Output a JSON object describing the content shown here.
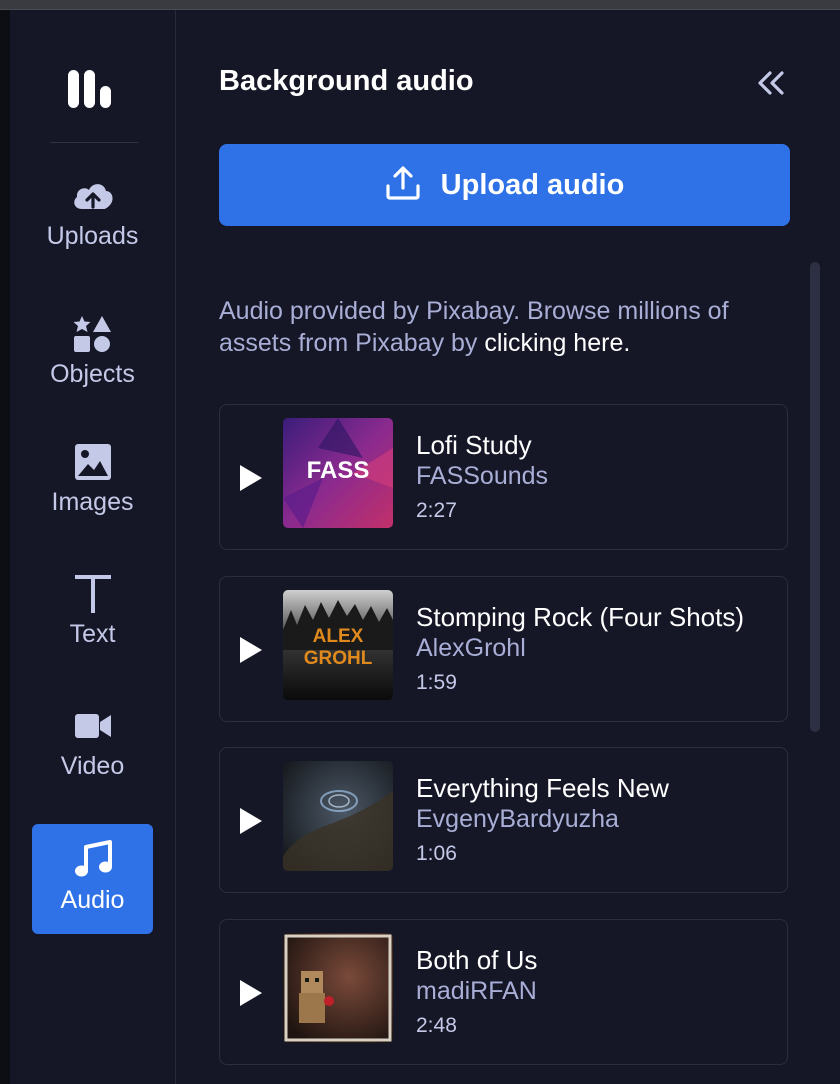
{
  "sidebar": {
    "items": [
      {
        "label": "Uploads",
        "icon": "cloud-upload-icon"
      },
      {
        "label": "Objects",
        "icon": "shapes-icon"
      },
      {
        "label": "Images",
        "icon": "image-icon"
      },
      {
        "label": "Text",
        "icon": "text-t-icon"
      },
      {
        "label": "Video",
        "icon": "video-camera-icon"
      },
      {
        "label": "Audio",
        "icon": "music-note-icon",
        "active": true
      }
    ]
  },
  "panel": {
    "title": "Background audio",
    "collapse_icon": "double-chevron-left-icon",
    "upload_label": "Upload audio",
    "credit_text": "Audio provided by Pixabay. Browse millions of assets from Pixabay by ",
    "credit_link": "clicking here."
  },
  "tracks": [
    {
      "title": "Lofi Study",
      "artist": "FASSounds",
      "duration": "2:27"
    },
    {
      "title": "Stomping Rock (Four Shots)",
      "artist": "AlexGrohl",
      "duration": "1:59"
    },
    {
      "title": "Everything Feels New",
      "artist": "EvgenyBardyuzha",
      "duration": "1:06"
    },
    {
      "title": "Both of Us",
      "artist": "madiRFAN",
      "duration": "2:48"
    }
  ],
  "thumb_text": {
    "fass": "FASS",
    "alex_line1": "ALEX",
    "alex_line2": "GROHL"
  },
  "colors": {
    "background": "#151726",
    "accent": "#2f72e8",
    "muted_text": "#a9aed6"
  }
}
